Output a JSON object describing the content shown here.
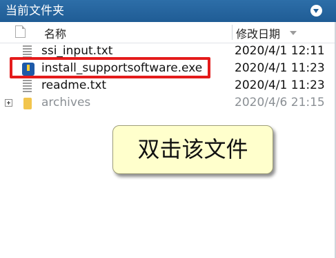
{
  "panel": {
    "title": "当前文件夹"
  },
  "columns": {
    "name": "名称",
    "modified": "修改日期"
  },
  "files": [
    {
      "name": "ssi_input.txt",
      "date": "2020/4/1 12:11",
      "icon": "text-file-icon"
    },
    {
      "name": "install_supportsoftware.exe",
      "date": "2020/4/1 11:23",
      "icon": "exe-file-icon"
    },
    {
      "name": "readme.txt",
      "date": "2020/4/1 11:23",
      "icon": "text-file-icon"
    },
    {
      "name": "archives",
      "date": "2020/4/6 21:15",
      "icon": "folder-icon"
    }
  ],
  "callout": {
    "text": "双击该文件"
  },
  "colors": {
    "titlebar": "#1f5c95",
    "highlight": "#e41b1b",
    "callout_bg": "#ffffcc"
  }
}
